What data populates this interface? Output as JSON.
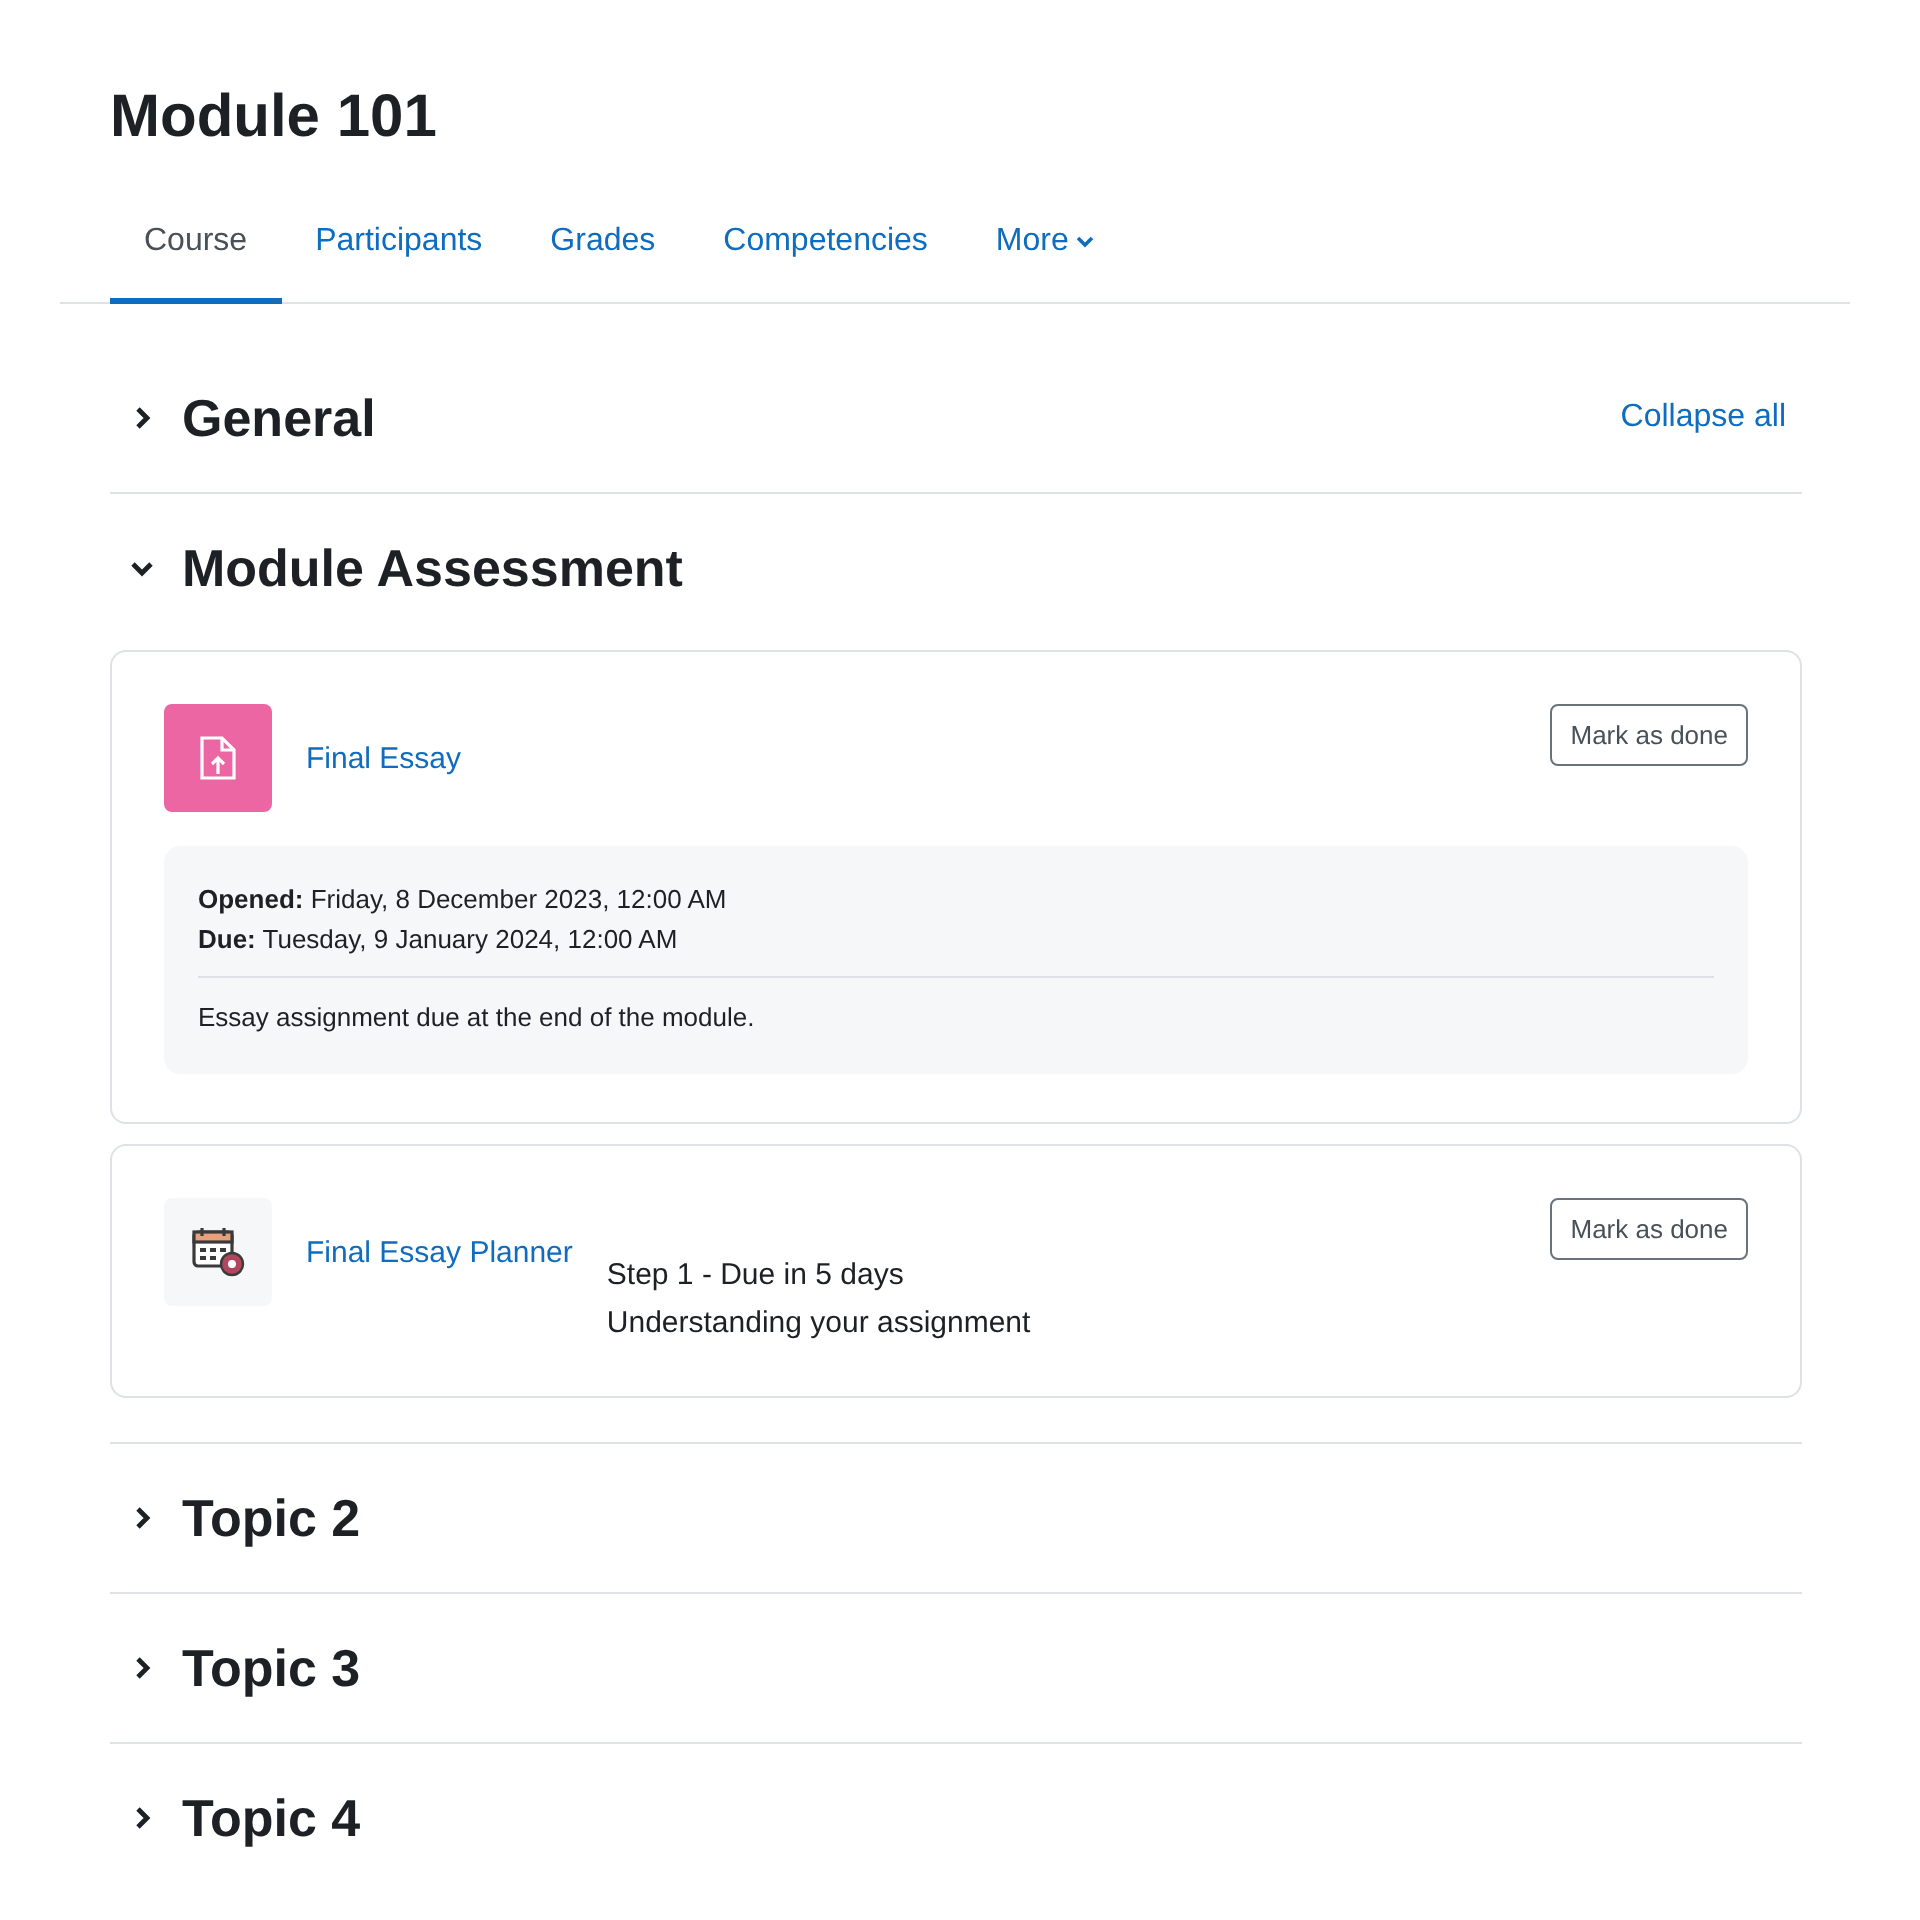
{
  "title": "Module 101",
  "tabs": [
    {
      "label": "Course",
      "selected": true
    },
    {
      "label": "Participants",
      "selected": false
    },
    {
      "label": "Grades",
      "selected": false
    },
    {
      "label": "Competencies",
      "selected": false
    },
    {
      "label": "More",
      "selected": false,
      "kind": "dropdown"
    }
  ],
  "collapse_all": "Collapse all",
  "sections": [
    {
      "title": "General",
      "expanded": false
    },
    {
      "title": "Module Assessment",
      "expanded": true,
      "activities": [
        {
          "kind": "assignment",
          "name": "Final Essay",
          "button": "Mark as done",
          "dates": [
            "**Opened:** Friday, 8 December 2023, 12:00 AM",
            "**Due:** Tuesday, 9 January 2024, 12:00 AM"
          ],
          "description": "Essay assignment due at the end of the module."
        },
        {
          "kind": "planner",
          "name": "Final Essay Planner",
          "button": "Mark as done",
          "lines": [
            "Step 1 - Due in 5 days",
            "Understanding your assignment"
          ]
        }
      ]
    },
    {
      "title": "Topic 2",
      "expanded": false
    },
    {
      "title": "Topic 3",
      "expanded": false
    },
    {
      "title": "Topic 4",
      "expanded": false
    }
  ]
}
